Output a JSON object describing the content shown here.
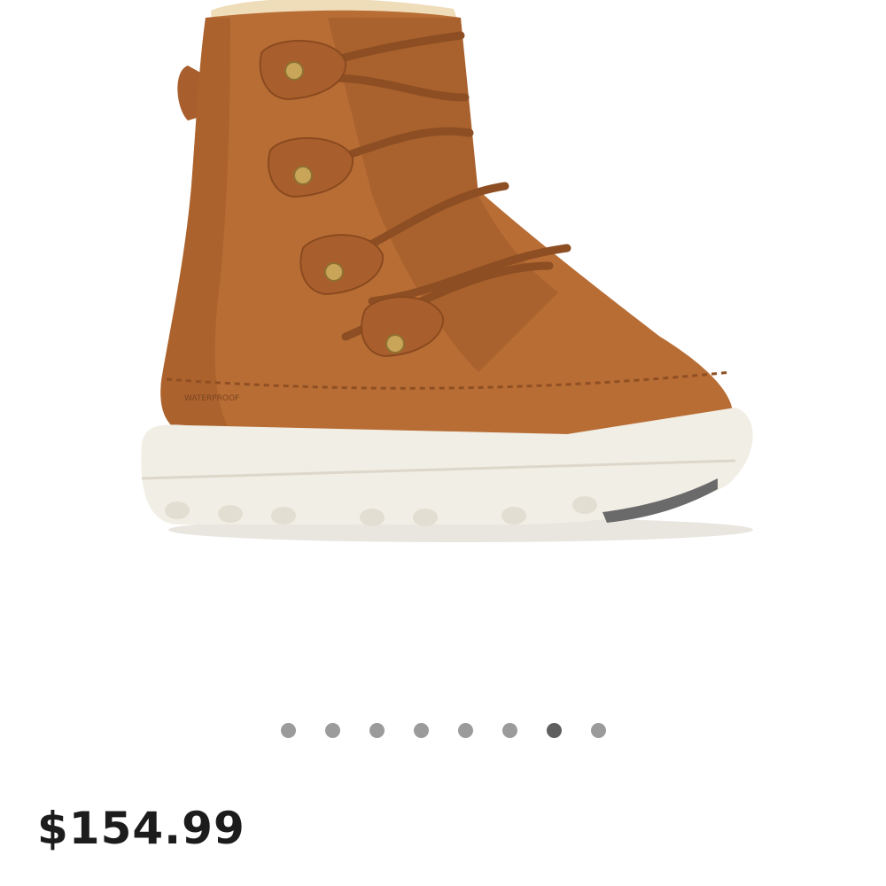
{
  "product": {
    "image_alt": "Brown suede lace-up winter boot with fur lining and white sole",
    "image_text": "WATERPROOF",
    "price": "$154.99"
  },
  "carousel": {
    "total": 8,
    "active_index": 6,
    "dot_color": "#9b9b9b",
    "active_dot_color": "#5f5f5f"
  },
  "colors": {
    "suede": "#b86d35",
    "suede_dark": "#8f4f22",
    "fur": "#efdcb9",
    "sole": "#f1eee5",
    "eyelet": "#c9a55a"
  }
}
